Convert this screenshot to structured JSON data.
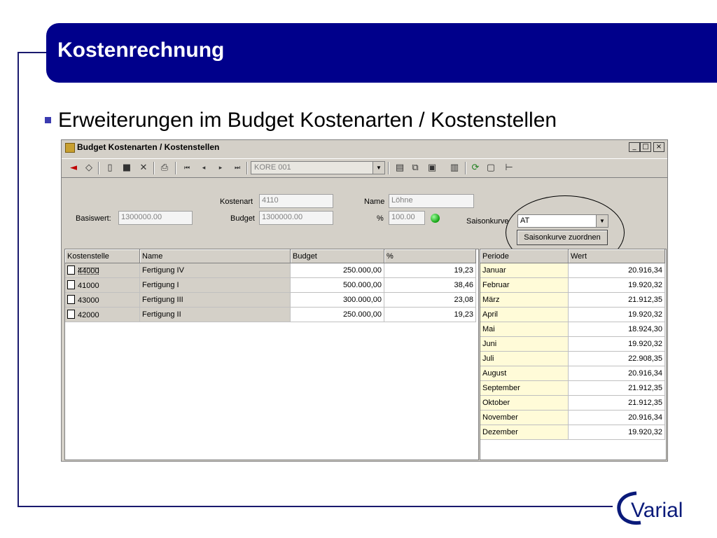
{
  "slide": {
    "title": "Kostenrechnung",
    "bullet": "Erweiterungen im Budget Kostenarten / Kostenstellen"
  },
  "window": {
    "title": "Budget Kostenarten / Kostenstellen",
    "minimize": "_",
    "maximize": "□",
    "close": "×"
  },
  "toolbar": {
    "combo_value": "KORE 001"
  },
  "form": {
    "kostenart_label": "Kostenart",
    "kostenart_value": "4110",
    "name_label": "Name",
    "name_value": "Löhne",
    "basiswert_label": "Basiswert:",
    "basiswert_value": "1300000.00",
    "budget_label": "Budget",
    "budget_value": "1300000.00",
    "percent_label": "%",
    "percent_value": "100.00",
    "saisonkurve_label": "Saisonkurve",
    "saisonkurve_value": "AT",
    "zuordnen_button": "Saisonkurve zuordnen"
  },
  "left_table": {
    "headers": [
      "Kostenstelle",
      "Name",
      "Budget",
      "%"
    ],
    "rows": [
      {
        "kst": "44000",
        "name": "Fertigung IV",
        "budget": "250.000,00",
        "pct": "19,23"
      },
      {
        "kst": "41000",
        "name": "Fertigung I",
        "budget": "500.000,00",
        "pct": "38,46"
      },
      {
        "kst": "43000",
        "name": "Fertigung III",
        "budget": "300.000,00",
        "pct": "23,08"
      },
      {
        "kst": "42000",
        "name": "Fertigung II",
        "budget": "250.000,00",
        "pct": "19,23"
      }
    ]
  },
  "right_table": {
    "headers": [
      "Periode",
      "Wert"
    ],
    "rows": [
      {
        "periode": "Januar",
        "wert": "20.916,34"
      },
      {
        "periode": "Februar",
        "wert": "19.920,32"
      },
      {
        "periode": "März",
        "wert": "21.912,35"
      },
      {
        "periode": "April",
        "wert": "19.920,32"
      },
      {
        "periode": "Mai",
        "wert": "18.924,30"
      },
      {
        "periode": "Juni",
        "wert": "19.920,32"
      },
      {
        "periode": "Juli",
        "wert": "22.908,35"
      },
      {
        "periode": "August",
        "wert": "20.916,34"
      },
      {
        "periode": "September",
        "wert": "21.912,35"
      },
      {
        "periode": "Oktober",
        "wert": "21.912,35"
      },
      {
        "periode": "November",
        "wert": "20.916,34"
      },
      {
        "periode": "Dezember",
        "wert": "19.920,32"
      }
    ]
  },
  "logo": {
    "text": "Varial"
  },
  "colors": {
    "title_bar": "#00008b",
    "window_bg": "#d4d0c8",
    "yellow_row": "#fffbd8",
    "led": "#10a010"
  }
}
